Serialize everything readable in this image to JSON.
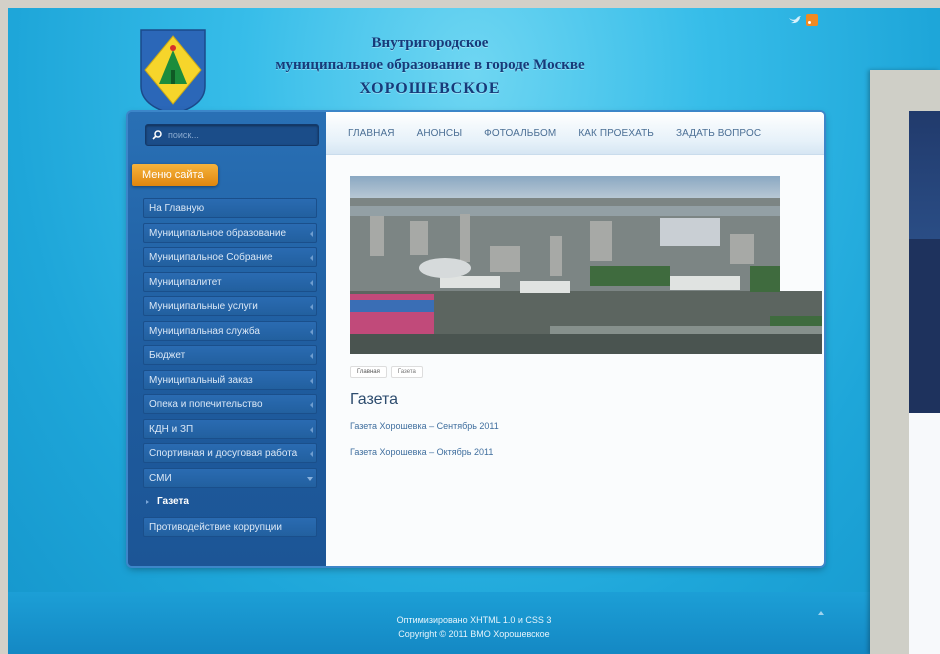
{
  "header": {
    "line1": "Внутригородское",
    "line2": "муниципальное образование в городе Москве",
    "line3": "ХОРОШЕВСКОЕ"
  },
  "search": {
    "placeholder": "поиск..."
  },
  "menu_title": "Меню сайта",
  "menu": {
    "items": [
      "На Главную",
      "Муниципальное образование",
      "Муниципальное Собрание",
      "Муниципалитет",
      "Муниципальные услуги",
      "Муниципальная служба",
      "Бюджет",
      "Муниципальный заказ",
      "Опека и попечительство",
      "КДН и ЗП",
      "Спортивная и досуговая работа",
      "СМИ"
    ],
    "subitem": "Газета",
    "last": "Противодействие коррупции"
  },
  "nav": {
    "items": [
      "ГЛАВНАЯ",
      "АНОНСЫ",
      "ФОТОАЛЬБОМ",
      "КАК ПРОЕХАТЬ",
      "ЗАДАТЬ ВОПРОС"
    ]
  },
  "breadcrumbs": [
    "Главная",
    "Газета"
  ],
  "page_title": "Газета",
  "links": [
    "Газета Хорошевка – Сентябрь 2011",
    "Газета Хорошевка – Октябрь 2011"
  ],
  "footer": {
    "line1": "Оптимизировано XHTML 1.0 и CSS 3",
    "line2": "Copyright © 2011 ВМО Хорошевское"
  },
  "colors": {
    "background": "#37bde9",
    "sidebar": "#2163a7",
    "accent": "#f0a02a",
    "title": "#173a79",
    "link": "#3f6e9e"
  },
  "icons": [
    "emblem-icon",
    "twitter-icon",
    "rss-icon",
    "search-icon",
    "scroll-up-icon"
  ]
}
